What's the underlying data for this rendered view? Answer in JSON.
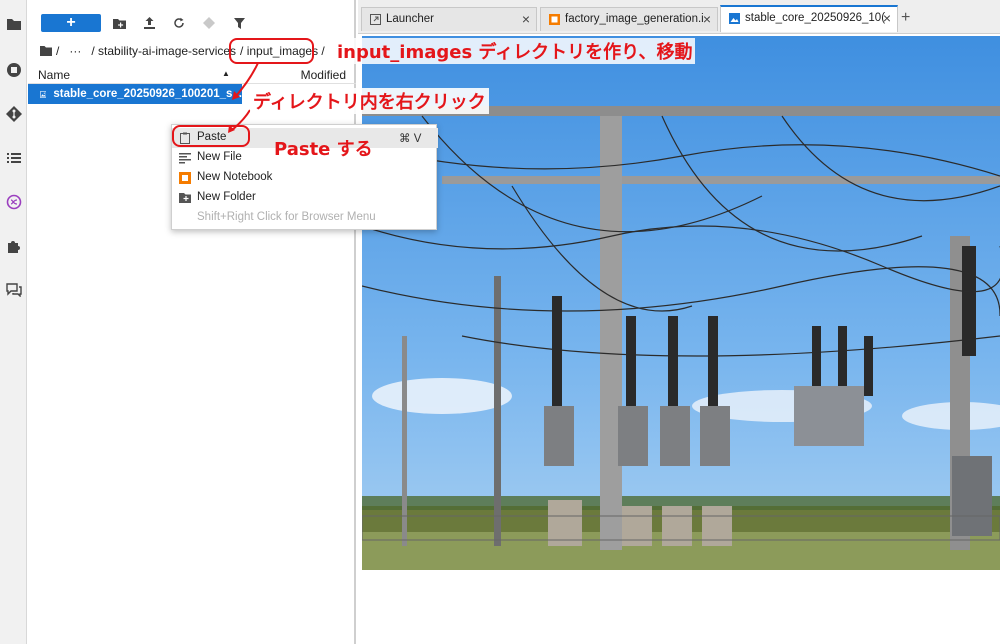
{
  "toolbar": {
    "new_button_label": "+"
  },
  "breadcrumb": {
    "root_sep": "/",
    "ellipsis": "···",
    "path_mid": "/ stability-ai-image-services",
    "path_current": "/ input_images /"
  },
  "file_list": {
    "col_name": "Name",
    "col_modified": "Modified",
    "sort_indicator": "▲",
    "files": [
      {
        "name": "stable_core_20250926_100201_s...",
        "icon": "image-file-icon",
        "selected": true
      }
    ]
  },
  "context_menu": {
    "items": [
      {
        "label": "Paste",
        "shortcut": "⌘ V",
        "icon": "clipboard-icon",
        "state": "hover"
      },
      {
        "label": "New File",
        "shortcut": "",
        "icon": "text-file-icon",
        "state": "normal"
      },
      {
        "label": "New Notebook",
        "shortcut": "",
        "icon": "notebook-icon",
        "state": "normal"
      },
      {
        "label": "New Folder",
        "shortcut": "",
        "icon": "new-folder-icon",
        "state": "normal"
      },
      {
        "label": "Shift+Right Click for Browser Menu",
        "shortcut": "",
        "icon": "",
        "state": "disabled"
      }
    ]
  },
  "tabs": [
    {
      "label": "Launcher",
      "icon": "launcher-icon",
      "active": false
    },
    {
      "label": "factory_image_generation.i",
      "icon": "notebook-icon",
      "active": false
    },
    {
      "label": "stable_core_20250926_10(",
      "icon": "image-file-icon",
      "active": true
    }
  ],
  "tab_add_label": "+",
  "annotations": {
    "step1": "input_images ディレクトリを作り、移動",
    "step2": "ディレクトリ内を右クリック",
    "step3": "Paste する"
  },
  "colors": {
    "accent": "#1976d2",
    "annotation": "#e4161a",
    "sky": "#5ea3e6"
  }
}
